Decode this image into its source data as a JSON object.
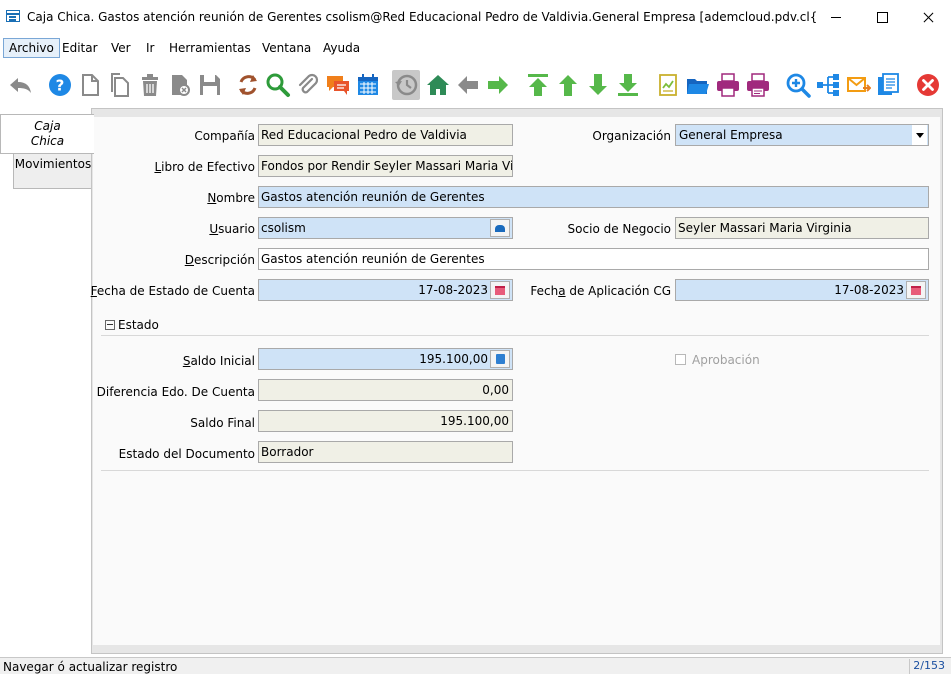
{
  "window": {
    "title": "Caja Chica.  Gastos atención reunión de Gerentes  csolism@Red Educacional Pedro de Valdivia.General Empresa [ademcloud.pdv.cl{oracloud.pdv.cl..."
  },
  "menu": [
    "Archivo",
    "Editar",
    "Ver",
    "Ir",
    "Herramientas",
    "Ventana",
    "Ayuda"
  ],
  "toolbar": {
    "icons": [
      "undo-icon",
      "help-icon",
      "new-record-icon",
      "copy-record-icon",
      "delete-icon",
      "delete-selection-icon",
      "save-icon",
      "refresh-icon",
      "find-icon",
      "attachment-icon",
      "chat-icon",
      "calendar-icon",
      "history-icon",
      "home-icon",
      "previous-icon",
      "next-icon",
      "first-record-icon",
      "parent-record-icon",
      "detail-record-icon",
      "last-record-icon",
      "report-icon",
      "archive-icon",
      "print-icon",
      "print-preview-icon",
      "zoom-across-icon",
      "workflow-icon",
      "request-icon",
      "product-info-icon",
      "exit-icon"
    ]
  },
  "tabs": {
    "caja_chica_line1": "Caja",
    "caja_chica_line2": "Chica",
    "movimientos": "Movimientos"
  },
  "form": {
    "compania": {
      "label": "Compañía",
      "value": "Red Educacional Pedro de Valdivia"
    },
    "organizacion": {
      "label": "Organización",
      "value": "General Empresa"
    },
    "libro": {
      "label_pre": "",
      "label_ul": "L",
      "label_post": "ibro de Efectivo",
      "value": "Fondos por Rendir Seyler  Massari  Maria Virg"
    },
    "nombre": {
      "label_ul": "N",
      "label_post": "ombre",
      "value": "Gastos atención reunión de Gerentes"
    },
    "usuario": {
      "label_ul": "U",
      "label_post": "suario",
      "value": "csolism"
    },
    "socio": {
      "label": "Socio de Negocio",
      "value": "Seyler  Massari  Maria Virginia"
    },
    "descripcion": {
      "label_ul": "D",
      "label_post": "escripción",
      "value": "Gastos atención reunión de Gerentes"
    },
    "fecha_estado": {
      "label_ul": "F",
      "label_post": "echa de Estado de Cuenta",
      "value": "17-08-2023"
    },
    "fecha_aplicacion": {
      "label_pre": "Fech",
      "label_ul": "a",
      "label_post": " de Aplicación CG",
      "value": "17-08-2023"
    }
  },
  "estado": {
    "section_label": "Estado",
    "saldo_inicial": {
      "label_ul": "S",
      "label_post": "aldo Inicial",
      "value": "195.100,00"
    },
    "diferencia": {
      "label": "Diferencia  Edo. De Cuenta",
      "value": "0,00"
    },
    "saldo_final": {
      "label": "Saldo Final",
      "value": "195.100,00"
    },
    "estado_documento": {
      "label": "Estado del Documento",
      "value": "Borrador"
    },
    "aprobacion": {
      "label": "Aprobación",
      "checked": false
    }
  },
  "status": {
    "text": "Navegar ó actualizar registro",
    "page": "2/153"
  },
  "colors": {
    "required_bg": "#cfe3f7",
    "readonly_bg": "#f0f0e6",
    "toolbar_green": "#56b84a",
    "toolbar_blue": "#1e88e5"
  }
}
